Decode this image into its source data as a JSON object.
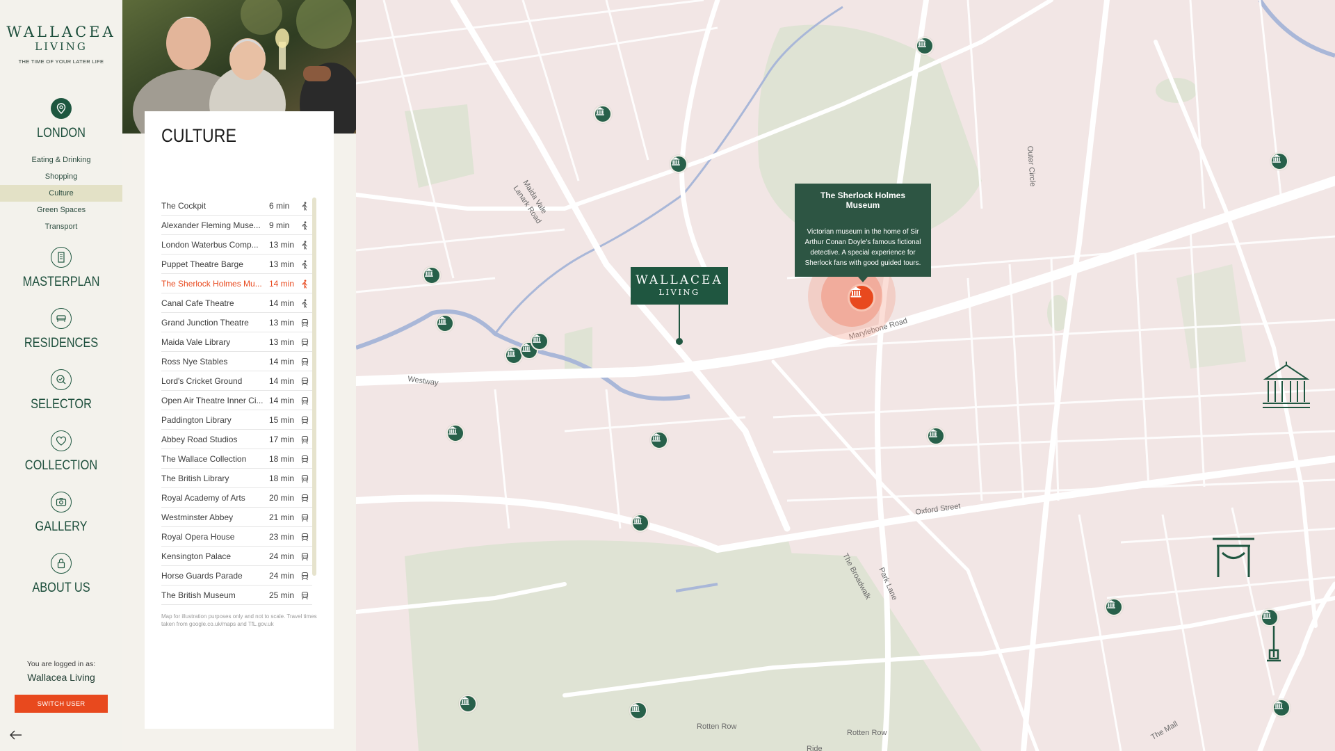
{
  "brand": {
    "line1": "WALLACEA",
    "line2": "LIVING",
    "tagline": "THE TIME OF YOUR LATER LIFE"
  },
  "nav": {
    "london": "LONDON",
    "sub": [
      "Eating & Drinking",
      "Shopping",
      "Culture",
      "Green Spaces",
      "Transport"
    ],
    "active_sub": "Culture",
    "masterplan": "MASTERPLAN",
    "residences": "RESIDENCES",
    "selector": "SELECTOR",
    "collection": "COLLECTION",
    "gallery": "GALLERY",
    "about": "ABOUT US"
  },
  "user": {
    "caption": "You are logged in as:",
    "name": "Wallacea Living",
    "switch_label": "SWITCH USER"
  },
  "panel": {
    "title": "CULTURE",
    "items": [
      {
        "name": "The Cockpit",
        "time": "6 min",
        "mode": "walk"
      },
      {
        "name": "Alexander Fleming Muse...",
        "time": "9 min",
        "mode": "walk"
      },
      {
        "name": "London Waterbus Comp...",
        "time": "13 min",
        "mode": "walk"
      },
      {
        "name": "Puppet Theatre Barge",
        "time": "13 min",
        "mode": "walk"
      },
      {
        "name": "The Sherlock Holmes Mu...",
        "time": "14 min",
        "mode": "walk",
        "active": true
      },
      {
        "name": "Canal Cafe Theatre",
        "time": "14 min",
        "mode": "walk"
      },
      {
        "name": "Grand Junction Theatre",
        "time": "13 min",
        "mode": "train"
      },
      {
        "name": "Maida Vale Library",
        "time": "13 min",
        "mode": "train"
      },
      {
        "name": "Ross Nye Stables",
        "time": "14 min",
        "mode": "train"
      },
      {
        "name": "Lord's Cricket Ground",
        "time": "14 min",
        "mode": "train"
      },
      {
        "name": "Open Air Theatre Inner Ci...",
        "time": "14 min",
        "mode": "train"
      },
      {
        "name": "Paddington Library",
        "time": "15 min",
        "mode": "train"
      },
      {
        "name": "Abbey Road Studios",
        "time": "17 min",
        "mode": "train"
      },
      {
        "name": "The Wallace Collection",
        "time": "18 min",
        "mode": "train"
      },
      {
        "name": "The British Library",
        "time": "18 min",
        "mode": "train"
      },
      {
        "name": "Royal Academy of Arts",
        "time": "20 min",
        "mode": "train"
      },
      {
        "name": "Westminster Abbey",
        "time": "21 min",
        "mode": "train"
      },
      {
        "name": "Royal Opera House",
        "time": "23 min",
        "mode": "train"
      },
      {
        "name": "Kensington Palace",
        "time": "24 min",
        "mode": "train"
      },
      {
        "name": "Horse Guards Parade",
        "time": "24 min",
        "mode": "train"
      },
      {
        "name": "The British Museum",
        "time": "25 min",
        "mode": "train"
      }
    ],
    "disclaimer": "Map for illustration purposes only and not to scale. Travel times taken from google.co.uk/maps and TfL.gov.uk"
  },
  "map": {
    "marker": {
      "line1": "WALLACEA",
      "line2": "LIVING"
    },
    "tooltip": {
      "title": "The Sherlock Holmes Museum",
      "description": "Victorian museum in the home of Sir Arthur Conan Doyle's famous fictional detective. A special experience for Sherlock fans with good guided tours."
    },
    "road_labels": [
      "Maida Vale",
      "Lanark Road",
      "Westway",
      "Marylebone Road",
      "Outer Circle",
      "Oxford Street",
      "The Broadwalk",
      "Park Lane",
      "Rotten Row",
      "Rotten Row",
      "The Mall",
      "Ride"
    ],
    "colors": {
      "accent": "#e8491e",
      "brand_green": "#1f5640",
      "map_bg": "#f2e6e5",
      "park": "#dfe3d4",
      "water": "#a9b7d8"
    }
  }
}
